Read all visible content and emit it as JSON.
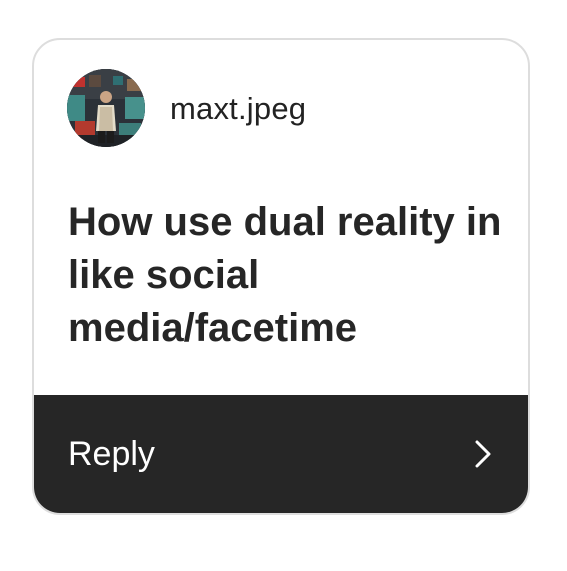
{
  "prompt_card": {
    "avatar_icon": "profile-photo",
    "username": "maxt.jpeg",
    "question": "How use dual reality in like social media/facetime",
    "reply": {
      "label": "Reply",
      "icon": "chevron-right-icon"
    }
  },
  "colors": {
    "card_border": "#dddddd",
    "text_dark": "#262626",
    "reply_background": "#262626",
    "reply_text": "#ffffff"
  }
}
